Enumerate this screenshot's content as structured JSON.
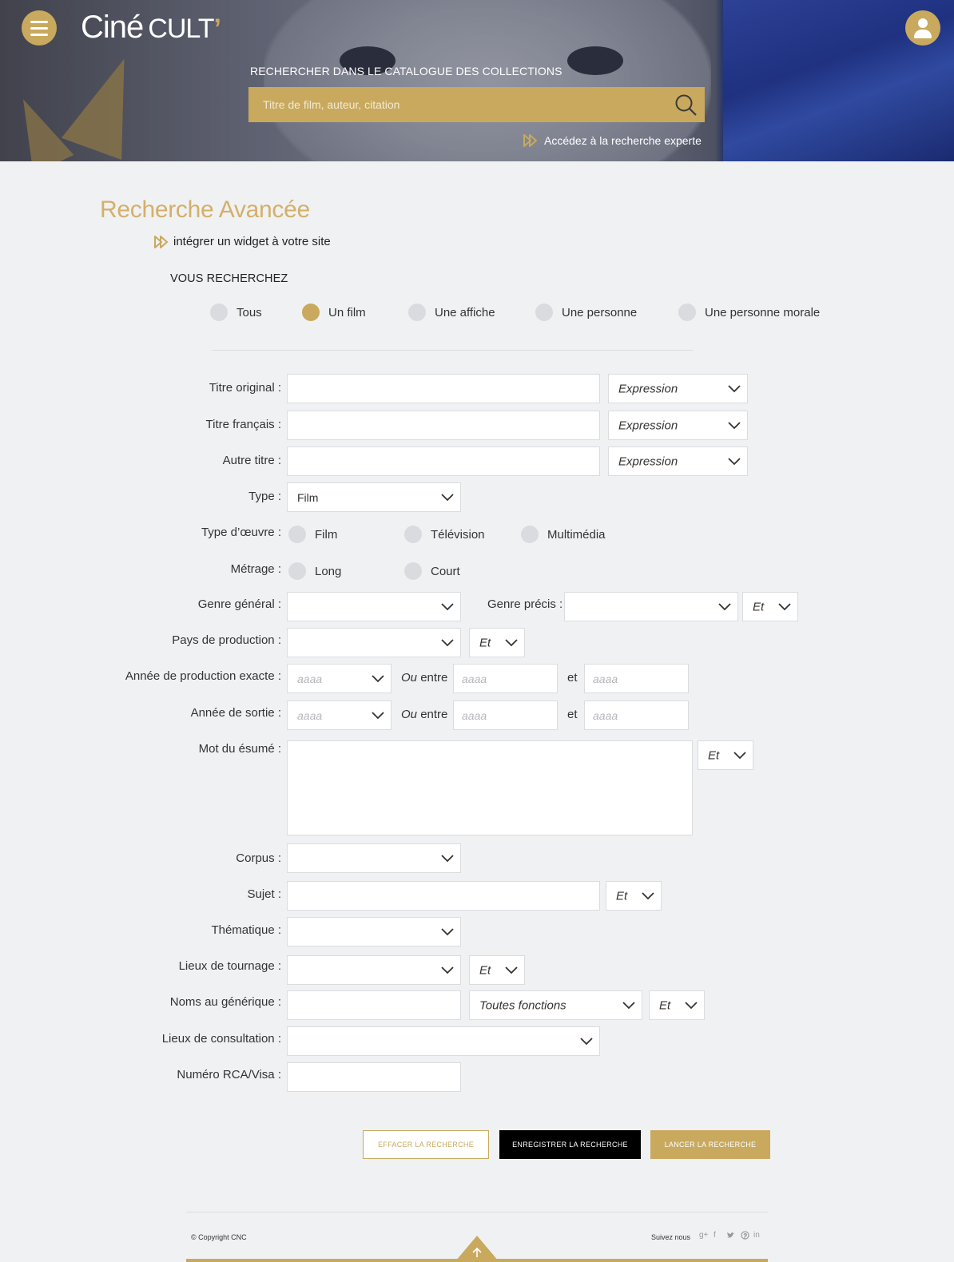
{
  "header": {
    "logo_cine": "Ciné",
    "logo_cult": "CULT",
    "logo_apos": "’",
    "search_label": "RECHERCHER DANS LE CATALOGUE DES COLLECTIONS",
    "search_placeholder": "Titre de film, auteur, citation",
    "expert_link": "Accédez à la recherche experte"
  },
  "page": {
    "title": "Recherche Avancée",
    "widget_link": "intégrer un widget à votre site",
    "vous_recherchez": "VOUS RECHERCHEZ"
  },
  "search_type": {
    "options": [
      "Tous",
      "Un film",
      "Une affiche",
      "Une personne",
      "Une personne morale"
    ],
    "selected": "Un film"
  },
  "form": {
    "titre_original": {
      "label": "Titre original :",
      "mode": "Expression"
    },
    "titre_francais": {
      "label": "Titre français :",
      "mode": "Expression"
    },
    "autre_titre": {
      "label": "Autre titre :",
      "mode": "Expression"
    },
    "type": {
      "label": "Type :",
      "value": "Film"
    },
    "type_oeuvre": {
      "label": "Type d’œuvre :",
      "options": [
        "Film",
        "Télévision",
        "Multimédia"
      ]
    },
    "metrage": {
      "label": "Métrage :",
      "options": [
        "Long",
        "Court"
      ]
    },
    "genre_general": {
      "label": "Genre général :",
      "value": ""
    },
    "genre_precis": {
      "label": "Genre précis :",
      "value": "",
      "op": "Et"
    },
    "pays": {
      "label": "Pays de production :",
      "value": "",
      "op": "Et"
    },
    "annee_production": {
      "label": "Année de production exacte :",
      "placeholder": "aaaa",
      "ou": "Ou",
      "entre": "entre",
      "et": "et"
    },
    "annee_sortie": {
      "label": "Année de sortie :",
      "placeholder": "aaaa",
      "ou": "Ou",
      "entre": "entre",
      "et": "et"
    },
    "mot_resume": {
      "label": "Mot du ésumé :",
      "op": "Et"
    },
    "corpus": {
      "label": "Corpus :",
      "value": ""
    },
    "sujet": {
      "label": "Sujet :",
      "op": "Et"
    },
    "thematique": {
      "label": "Thématique :",
      "value": ""
    },
    "lieux_tournage": {
      "label": "Lieux de tournage :",
      "value": "",
      "op": "Et"
    },
    "noms_generique": {
      "label": "Noms au générique :",
      "fonctions": "Toutes fonctions",
      "op": "Et"
    },
    "lieux_consultation": {
      "label": "Lieux de consultation :",
      "value": ""
    },
    "numero_rca": {
      "label": "Numéro RCA/Visa :"
    }
  },
  "actions": {
    "clear": "EFFACER LA RECHERCHE",
    "save": "ENREGISTRER LA RECHERCHE",
    "run": "LANCER LA RECHERCHE"
  },
  "footer": {
    "copyright": "© Copyright CNC",
    "follow": "Suivez nous",
    "social": [
      "g+",
      "f",
      "twitter",
      "pinterest",
      "in"
    ]
  },
  "colors": {
    "accent": "#c8a95e",
    "title": "#d3b06a",
    "background": "#f0f1f3"
  }
}
